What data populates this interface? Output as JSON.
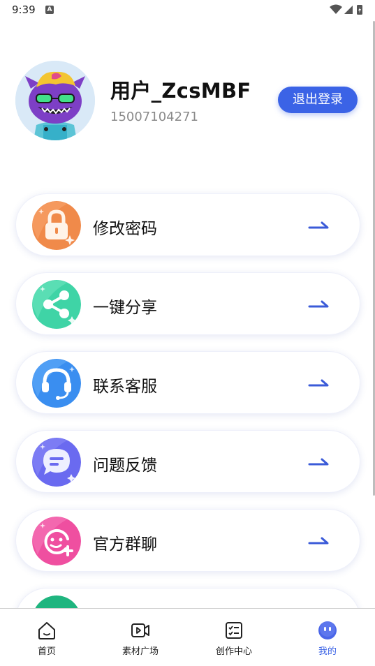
{
  "status_bar": {
    "time": "9:39",
    "notification_icon": "A"
  },
  "profile": {
    "name": "用户_ZcsMBF",
    "phone": "15007104271",
    "logout_label": "退出登录"
  },
  "menu": [
    {
      "label": "修改密码",
      "icon": "lock-icon",
      "color": "#f08a4a"
    },
    {
      "label": "一键分享",
      "icon": "share-icon",
      "color": "#3fd4a6"
    },
    {
      "label": "联系客服",
      "icon": "headset-icon",
      "color": "#3a8ef0"
    },
    {
      "label": "问题反馈",
      "icon": "feedback-icon",
      "color": "#6a6af0"
    },
    {
      "label": "官方群聊",
      "icon": "group-chat-icon",
      "color": "#ef4fa0"
    },
    {
      "label": "",
      "icon": "more-icon",
      "color": "#1fb57f"
    }
  ],
  "tab_bar": {
    "tabs": [
      {
        "label": "首页",
        "icon": "home-icon"
      },
      {
        "label": "素材广场",
        "icon": "video-icon"
      },
      {
        "label": "创作中心",
        "icon": "checklist-icon"
      },
      {
        "label": "我的",
        "icon": "profile-face-icon",
        "active": true
      }
    ]
  },
  "colors": {
    "accent": "#3b63e6"
  }
}
